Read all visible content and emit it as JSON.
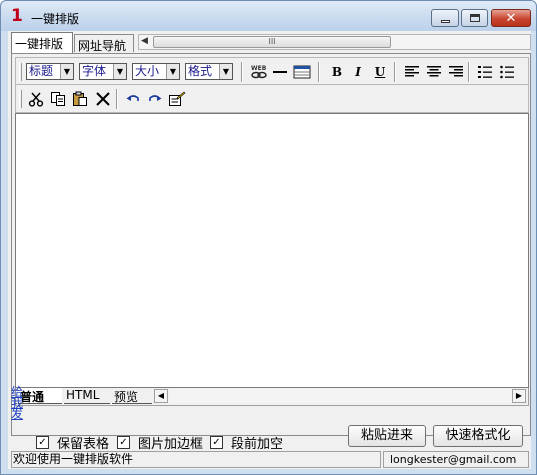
{
  "window": {
    "app_icon": "1",
    "title": "一键排版"
  },
  "tabs": [
    {
      "label": "一键排版",
      "active": true
    },
    {
      "label": "网址导航",
      "active": false
    }
  ],
  "top_scroll": {
    "grip": "III"
  },
  "toolbar1": {
    "combos": [
      "标题",
      "字体",
      "大小",
      "格式"
    ],
    "bold": "B",
    "italic": "I",
    "underline": "U"
  },
  "bottom_tabs": [
    {
      "label": "普通",
      "active": true
    },
    {
      "label": "HTML",
      "active": false
    },
    {
      "label": "预览",
      "active": false
    }
  ],
  "feedback_link": "给我发",
  "options": [
    {
      "label": "保留表格",
      "checked": true
    },
    {
      "label": "图片加边框",
      "checked": true
    },
    {
      "label": "段前加空",
      "checked": true
    }
  ],
  "buttons": {
    "paste": "粘贴进来",
    "quick_format": "快速格式化"
  },
  "status": {
    "message": "欢迎使用一键排版软件",
    "email": "longkester@gmail.com"
  }
}
